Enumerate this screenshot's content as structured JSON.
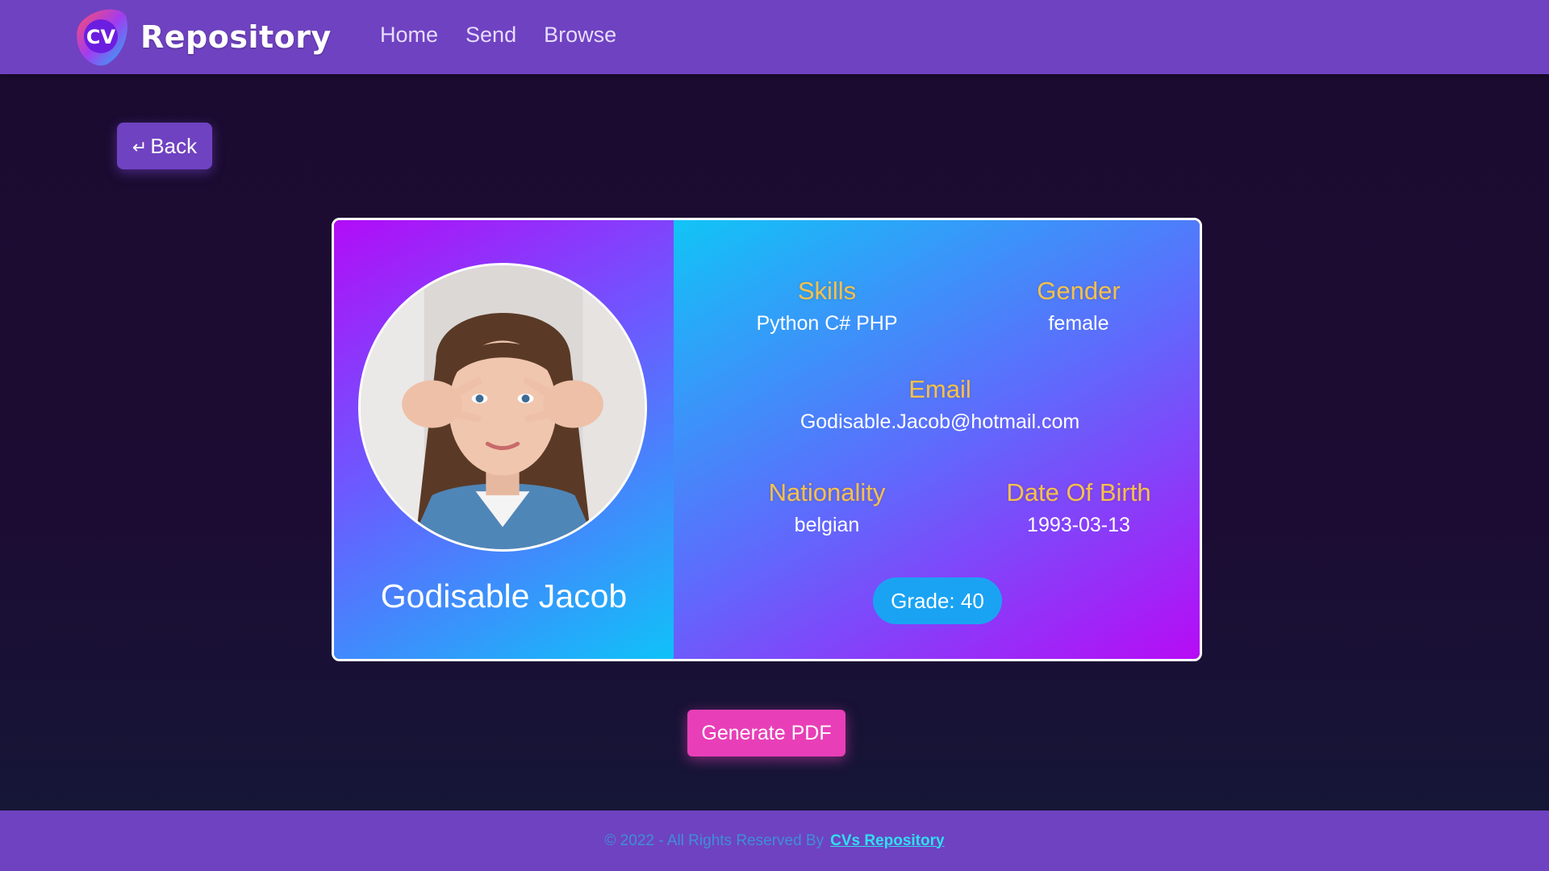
{
  "navbar": {
    "logo_text": "CV",
    "brand": "Repository",
    "links": [
      "Home",
      "Send",
      "Browse"
    ]
  },
  "back_button": {
    "icon": "return-arrow-icon",
    "label": "Back"
  },
  "profile": {
    "name": "Godisable Jacob",
    "skills_label": "Skills",
    "skills": "Python C# PHP",
    "gender_label": "Gender",
    "gender": "female",
    "email_label": "Email",
    "email": "Godisable.Jacob@hotmail.com",
    "nationality_label": "Nationality",
    "nationality": "belgian",
    "dob_label": "Date Of Birth",
    "dob": "1993-03-13",
    "grade": "Grade: 40"
  },
  "pdf_button": {
    "label": "Generate PDF"
  },
  "footer": {
    "copyright": "© 2022 - All Rights Reserved By",
    "link": "CVs Repository"
  },
  "colors": {
    "navbar": "#6f42c1",
    "accent_label": "#f5c14c",
    "pdf_button": "#e83fb8",
    "grade_badge": "#1aa3f3"
  }
}
